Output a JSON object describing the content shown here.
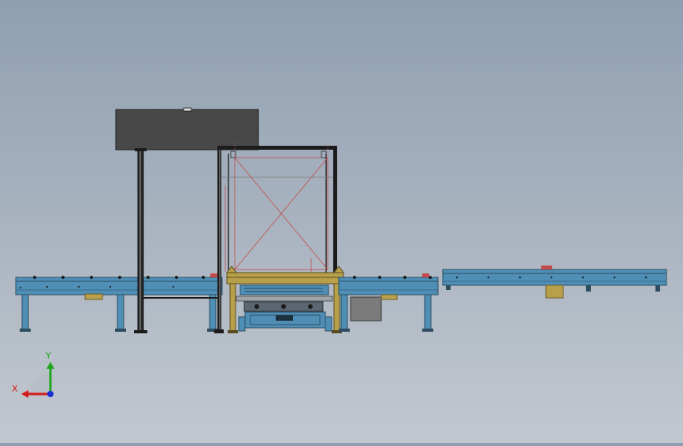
{
  "viewport": {
    "background_top": "#8f9fb1",
    "background_bottom": "#c2c8cf"
  },
  "colors": {
    "conveyor_blue": "#4f8fb6",
    "conveyor_dark": "#2d4c60",
    "frame_black": "#1c1c1c",
    "yellow_frame": "#b8a04a",
    "panel_gray": "#4a4a4a",
    "box_gray": "#7b7b7b",
    "motion_red": "#c44a4a",
    "axis_x": "#d41b1b",
    "axis_y": "#1fa51f",
    "axis_z": "#1b2fd4"
  },
  "triad": {
    "x_label": "X",
    "y_label": "Y",
    "x_icon": "x-axis-arrow-icon",
    "y_icon": "y-axis-arrow-icon",
    "z_icon": "z-axis-dot-icon"
  }
}
